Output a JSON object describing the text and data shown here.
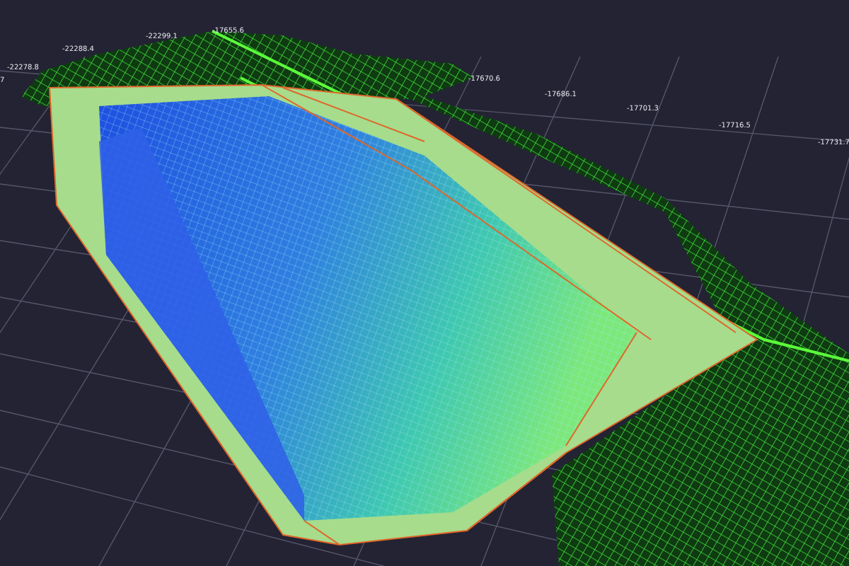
{
  "scene": {
    "coordinate_labels": [
      "7",
      "-22278.8",
      "-22288.4",
      "-22299.1",
      "-17655.6",
      "-17670.6",
      "-17686.1",
      "-17701.3",
      "-17716.5",
      "-17731.7"
    ]
  }
}
